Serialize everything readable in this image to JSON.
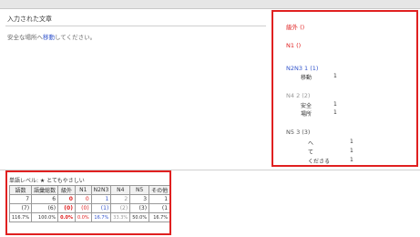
{
  "input_panel": {
    "title": "入力された文章",
    "text_before": "安全な場所へ",
    "text_link": "移動",
    "text_after": "してください。"
  },
  "levels": {
    "out": {
      "label": "級外 ()"
    },
    "n1": {
      "label": "N1 ()"
    },
    "n2n3": {
      "label": "N2N3 1 (1)",
      "words": [
        {
          "word": "移動",
          "count": "1"
        }
      ]
    },
    "n4": {
      "label": "N4 2 (2)",
      "words": [
        {
          "word": "安全",
          "count": "1"
        },
        {
          "word": "場所",
          "count": "1"
        }
      ]
    },
    "n5": {
      "label": "N5 3 (3)",
      "words": [
        {
          "word": "へ",
          "count": "1"
        },
        {
          "word": "て",
          "count": "1"
        },
        {
          "word": "くださる",
          "count": "1"
        }
      ]
    }
  },
  "stats": {
    "title": "単語レベル: ★ とてもやさしい",
    "headers": [
      "語数",
      "語彙総数",
      "級外",
      "N1",
      "N2N3",
      "N4",
      "N5",
      "その他"
    ],
    "rows": [
      [
        "7",
        "6",
        "0",
        "0",
        "1",
        "2",
        "3",
        "1"
      ],
      [
        "(7)",
        "(6)",
        "(0)",
        "(0)",
        "(1)",
        "(2)",
        "(3)",
        "(1"
      ],
      [
        "116.7%",
        "100.0%",
        "0.0%",
        "0.0%",
        "16.7%",
        "33.3%",
        "50.0%",
        "16.7%"
      ]
    ]
  },
  "colors": {
    "red": "#e02020",
    "blue": "#3355cc",
    "grey": "#999999"
  }
}
